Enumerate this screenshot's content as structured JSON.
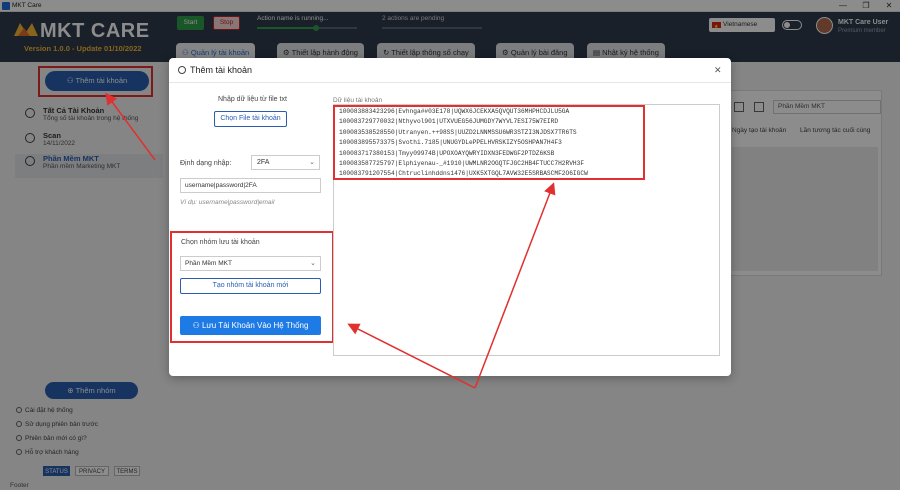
{
  "window": {
    "title": "MKT Care",
    "controls": [
      "—",
      "❐",
      "✕"
    ]
  },
  "header": {
    "logo_text": "MKT CARE",
    "version": "Version 1.0.0 - Update 01/10/2022",
    "start_label": "Start",
    "stop_label": "Stop",
    "status_running": "Action name is running...",
    "status_pending": "2 actions are pending",
    "progress_running": 0.58,
    "progress_pending": 0,
    "language": "Vietnamese",
    "user_name": "MKT Care User",
    "user_role": "Premium member"
  },
  "tabs": [
    {
      "label": "Quản lý tài khoản",
      "icon": "user-icon",
      "active": true
    },
    {
      "label": "Thiết lập hành động",
      "icon": "gear-icon",
      "active": false
    },
    {
      "label": "Thiết lập thông số chạy",
      "icon": "refresh-icon",
      "active": false
    },
    {
      "label": "Quản lý bài đăng",
      "icon": "gear-icon",
      "active": false
    },
    {
      "label": "Nhật ký hệ thống",
      "icon": "log-icon",
      "active": false
    }
  ],
  "sidebar": {
    "add_account_label": "Thêm tài khoản",
    "groups": [
      {
        "title": "Tất Cả Tài Khoản",
        "subtitle": "Tổng số tài khoản trong hệ thống"
      },
      {
        "title": "Scan",
        "subtitle": "14/11/2022"
      },
      {
        "title": "Phần Mềm MKT",
        "subtitle": "Phần mềm Marketing MKT"
      }
    ],
    "add_group_label": "Thêm nhóm",
    "menu": [
      "Cài đặt hệ thống",
      "Sử dụng phiên bản trước",
      "Phiên bản mới có gì?",
      "Hỗ trợ khách hàng"
    ],
    "footer_buttons": [
      "STATUS",
      "PRIVACY",
      "TERMS"
    ],
    "footer_text": "Footer"
  },
  "background": {
    "select_value": "Phần Mềm MKT",
    "columns": [
      "Ngày tạo tài khoản",
      "Lần tương tác cuối cùng"
    ]
  },
  "modal": {
    "title": "Thêm tài khoản",
    "import_label": "Nhập dữ liệu từ file txt",
    "choose_file_label": "Chọn File tài khoản",
    "format_label": "Định dạng nhập:",
    "format_value": "2FA",
    "format_input": "username|password|2FA",
    "format_hint": "Ví dụ: username|password|email",
    "group_label": "Chọn nhóm lưu tài khoản",
    "group_value": "Phần Mềm MKT",
    "new_group_label": "Tạo nhóm tài khoản mới",
    "save_label": "Lưu Tài Khoản Vào Hệ Thống",
    "data_label": "Dữ liệu tài khoản",
    "data_lines": [
      "100083883423296|Evhnga##03E178|UQWX6JCEKXA5QVQUT36MHPHCDJLU5GA",
      "100083729770032|Nthyvol901|UTXVUEG56JUMGDY7WYVL7ESI75W7EIRD",
      "100083538528550|Utranyen.++98SS|UUZD2LNNMSSU6WR3STZI3NJDSX7TR6TS",
      "100083895573375|Svothi.7185|UNUGYDLePPELHVRSKIZY5OSHPAN7H4F3",
      "100083717380153|Tmyy09974B|UPOXOAYQWRYIDXN3FEDWGF2PTDZ6KSB",
      "100083587725797|Elphiyenau-_#1910|UWMLNR2OGQTFJGC2HB4FTUCC7H2RVH3F",
      "100083791207554|Chtruclinhddns1476|UXK5XTGQL7AVW32E5SRBASCMF2O6IGCW"
    ]
  }
}
